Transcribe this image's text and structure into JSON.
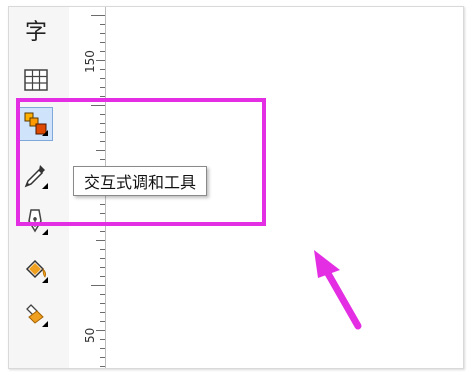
{
  "toolbox": {
    "text_tool_glyph": "字",
    "tools": [
      {
        "name": "text-tool"
      },
      {
        "name": "table-tool"
      },
      {
        "name": "interactive-blend-tool"
      },
      {
        "name": "eyedropper-tool"
      },
      {
        "name": "outline-pen-tool"
      },
      {
        "name": "fill-bucket-tool"
      },
      {
        "name": "interactive-fill-tool"
      }
    ]
  },
  "ruler": {
    "labels": [
      "150",
      "50"
    ]
  },
  "tooltip": {
    "text": "交互式调和工具"
  },
  "colors": {
    "highlight": "#e32ee3",
    "arrow": "#e32ee3",
    "active_tool_bg": "#cfe3fb"
  }
}
